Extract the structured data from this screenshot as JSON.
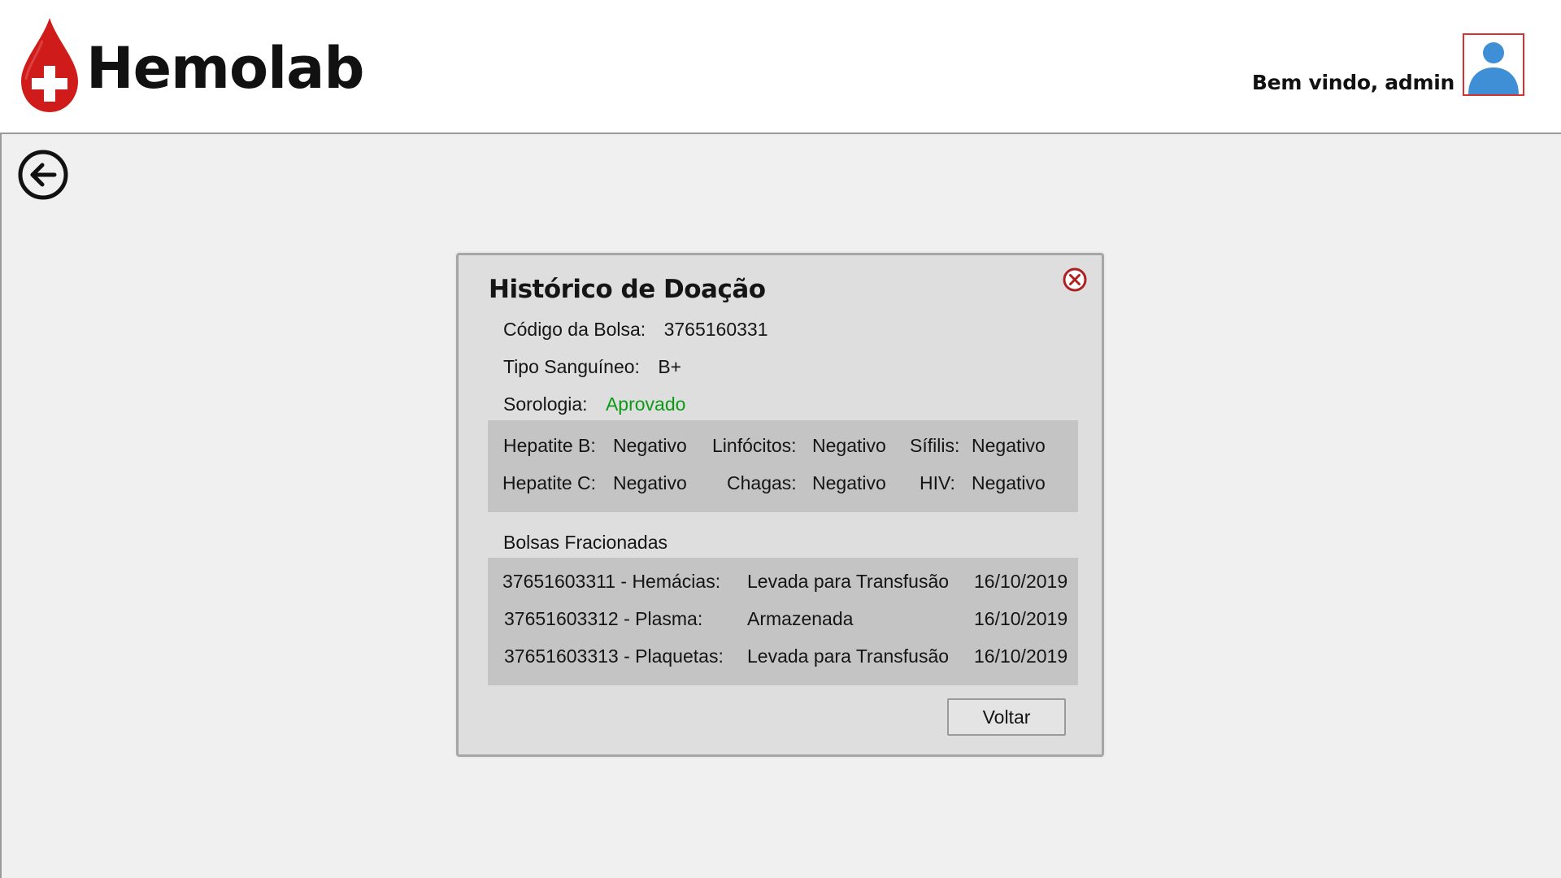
{
  "app": {
    "name": "Hemolab"
  },
  "header": {
    "welcome": "Bem vindo, admin"
  },
  "dialog": {
    "title": "Histórico de Doação",
    "codigo_label": "Código da Bolsa:",
    "codigo_value": "3765160331",
    "tipo_label": "Tipo Sanguíneo:",
    "tipo_value": "B+",
    "sorologia_label": "Sorologia:",
    "sorologia_value": "Aprovado",
    "tests": [
      {
        "label": "Hepatite B:",
        "value": "Negativo"
      },
      {
        "label": "Linfócitos:",
        "value": "Negativo"
      },
      {
        "label": "Sífilis:",
        "value": "Negativo"
      },
      {
        "label": "Hepatite C:",
        "value": "Negativo"
      },
      {
        "label": "Chagas:",
        "value": "Negativo"
      },
      {
        "label": "HIV:",
        "value": "Negativo"
      }
    ],
    "fracionadas_title": "Bolsas Fracionadas",
    "fracionadas": [
      {
        "name": "37651603311 - Hemácias:",
        "status": "Levada para Transfusão",
        "date": "16/10/2019"
      },
      {
        "name": "37651603312 - Plasma:",
        "status": "Armazenada",
        "date": "16/10/2019"
      },
      {
        "name": "37651603313 - Plaquetas:",
        "status": "Levada para Transfusão",
        "date": "16/10/2019"
      }
    ],
    "voltar_label": "Voltar"
  },
  "icons": {
    "logo": "blood-drop-cross-icon",
    "avatar": "user-icon",
    "back": "arrow-left-circle-icon",
    "close": "close-circle-icon"
  },
  "colors": {
    "brand_red": "#d01b1b",
    "positive_green": "#0c9a16",
    "avatar_blue": "#3f8fd6"
  }
}
